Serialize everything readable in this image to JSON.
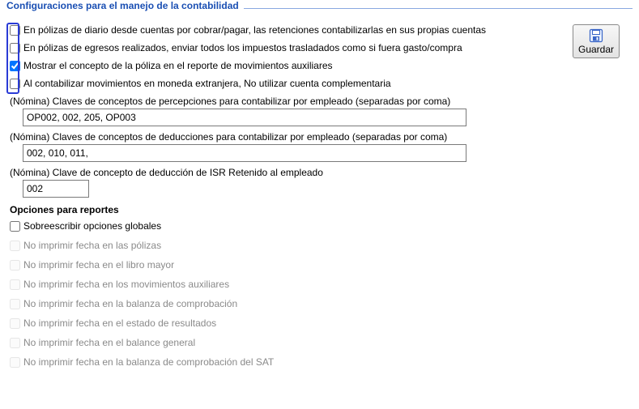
{
  "groupTitle": "Configuraciones para el manejo de la contabilidad",
  "checks": {
    "c1": {
      "label": "En pólizas de diario desde cuentas por cobrar/pagar, las retenciones contabilizarlas en sus propias cuentas",
      "checked": false
    },
    "c2": {
      "label": "En pólizas de egresos realizados, enviar todos los impuestos trasladados como si fuera gasto/compra",
      "checked": false
    },
    "c3": {
      "label": "Mostrar el concepto de la póliza en el reporte de movimientos auxiliares",
      "checked": true
    },
    "c4": {
      "label": "Al contabilizar movimientos en moneda extranjera, No utilizar cuenta complementaria",
      "checked": false
    }
  },
  "fields": {
    "percepciones": {
      "label": "(Nómina) Claves de conceptos de percepciones para contabilizar por empleado (separadas por coma)",
      "value": "OP002, 002, 205, OP003"
    },
    "deducciones": {
      "label": "(Nómina) Claves de conceptos de deducciones para contabilizar por empleado (separadas por coma)",
      "value": "002, 010, 011,"
    },
    "isr": {
      "label": "(Nómina) Clave de concepto de deducción de ISR Retenido al empleado",
      "value": "002"
    }
  },
  "reportsTitle": "Opciones para reportes",
  "reports": {
    "r0": {
      "label": "Sobreescribir opciones globales",
      "enabled": true
    },
    "r1": {
      "label": "No imprimir fecha en las pólizas",
      "enabled": false
    },
    "r2": {
      "label": "No imprimir fecha en el libro mayor",
      "enabled": false
    },
    "r3": {
      "label": "No imprimir fecha en los movimientos auxiliares",
      "enabled": false
    },
    "r4": {
      "label": "No imprimir fecha en la balanza de comprobación",
      "enabled": false
    },
    "r5": {
      "label": "No imprimir fecha en el estado de resultados",
      "enabled": false
    },
    "r6": {
      "label": "No imprimir fecha en el balance general",
      "enabled": false
    },
    "r7": {
      "label": "No imprimir fecha en la balanza de comprobación del SAT",
      "enabled": false
    }
  },
  "saveLabel": "Guardar"
}
